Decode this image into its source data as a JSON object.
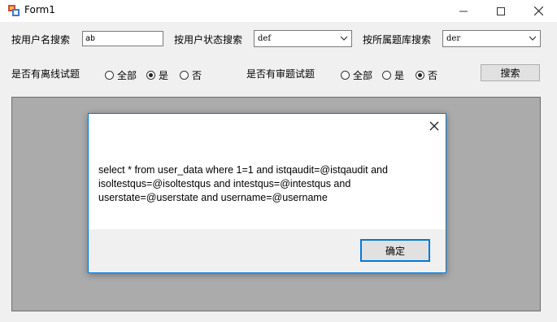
{
  "window": {
    "title": "Form1"
  },
  "filters": {
    "username": {
      "label": "按用户名搜索",
      "value": "ab"
    },
    "userstate": {
      "label": "按用户状态搜索",
      "value": "def"
    },
    "library": {
      "label": "按所属题库搜索",
      "value": "der"
    }
  },
  "offline": {
    "label": "是否有离线试题",
    "options": [
      "全部",
      "是",
      "否"
    ],
    "selected": "是"
  },
  "audit": {
    "label": "是否有审题试题",
    "options": [
      "全部",
      "是",
      "否"
    ],
    "selected": "否"
  },
  "search_button": "搜索",
  "dialog": {
    "message_lines": [
      "select * from user_data where 1=1  and istqaudit=@istqaudit  and",
      "isoltestqus=@isoltestqus  and intestqus=@intestqus  and",
      "userstate=@userstate  and username=@username"
    ],
    "ok_button": "确定"
  }
}
